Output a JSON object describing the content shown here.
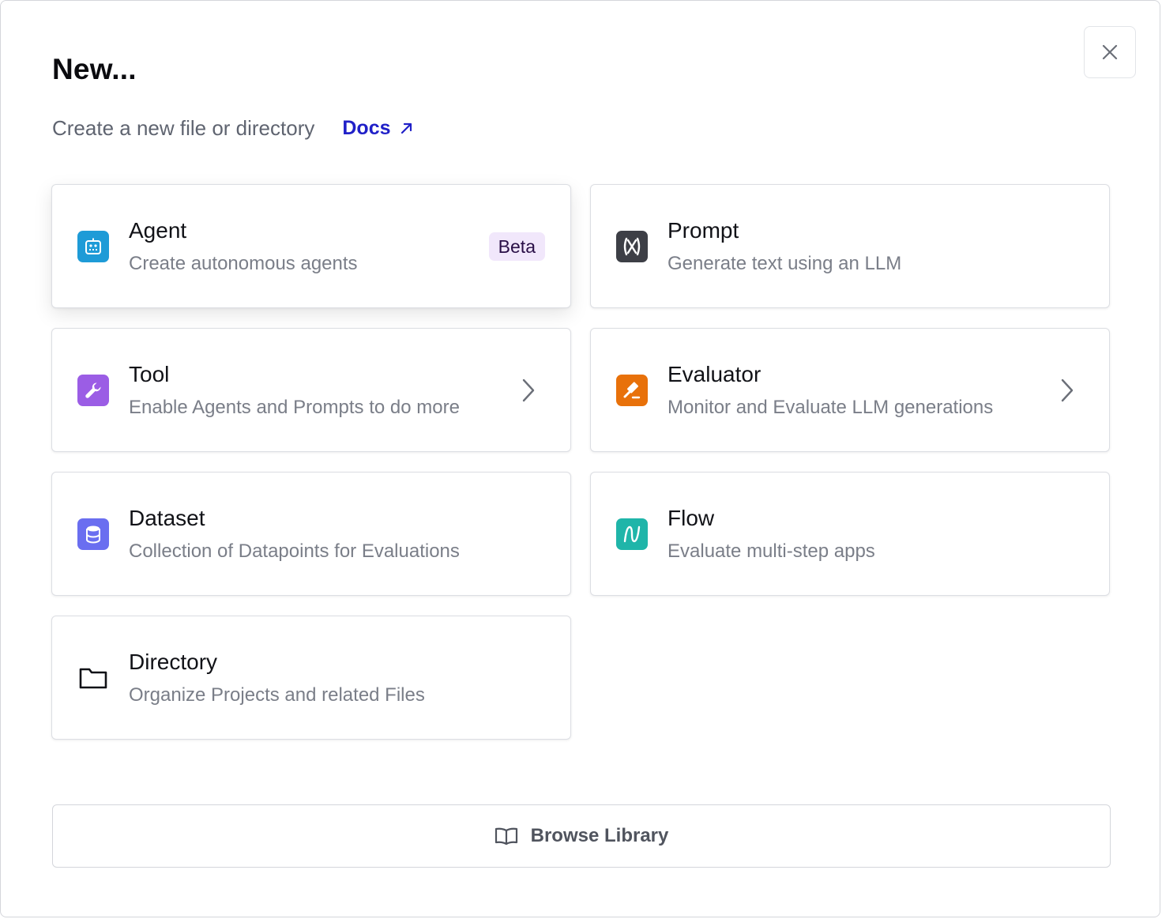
{
  "dialog": {
    "title": "New...",
    "subtitle": "Create a new file or directory",
    "docs_link": "Docs",
    "close_icon": "close-icon"
  },
  "cards": [
    {
      "id": "agent",
      "title": "Agent",
      "description": "Create autonomous agents",
      "icon": "robot-icon",
      "icon_color": "#1e9bd7",
      "badge": "Beta"
    },
    {
      "id": "prompt",
      "title": "Prompt",
      "description": "Generate text using an LLM",
      "icon": "prompt-icon",
      "icon_color": "#3d3f46"
    },
    {
      "id": "tool",
      "title": "Tool",
      "description": "Enable Agents and Prompts to do more",
      "icon": "wrench-icon",
      "icon_color": "#9b5de5",
      "has_submenu": true
    },
    {
      "id": "evaluator",
      "title": "Evaluator",
      "description": "Monitor and Evaluate LLM generations",
      "icon": "gavel-icon",
      "icon_color": "#e8710a",
      "has_submenu": true
    },
    {
      "id": "dataset",
      "title": "Dataset",
      "description": "Collection of Datapoints for Evaluations",
      "icon": "database-icon",
      "icon_color": "#6a6ef0"
    },
    {
      "id": "flow",
      "title": "Flow",
      "description": "Evaluate multi-step apps",
      "icon": "flow-icon",
      "icon_color": "#1fb5a9"
    },
    {
      "id": "directory",
      "title": "Directory",
      "description": "Organize Projects and related Files",
      "icon": "folder-icon",
      "icon_color": "#111217"
    }
  ],
  "footer": {
    "browse_label": "Browse Library",
    "browse_icon": "book-icon"
  }
}
